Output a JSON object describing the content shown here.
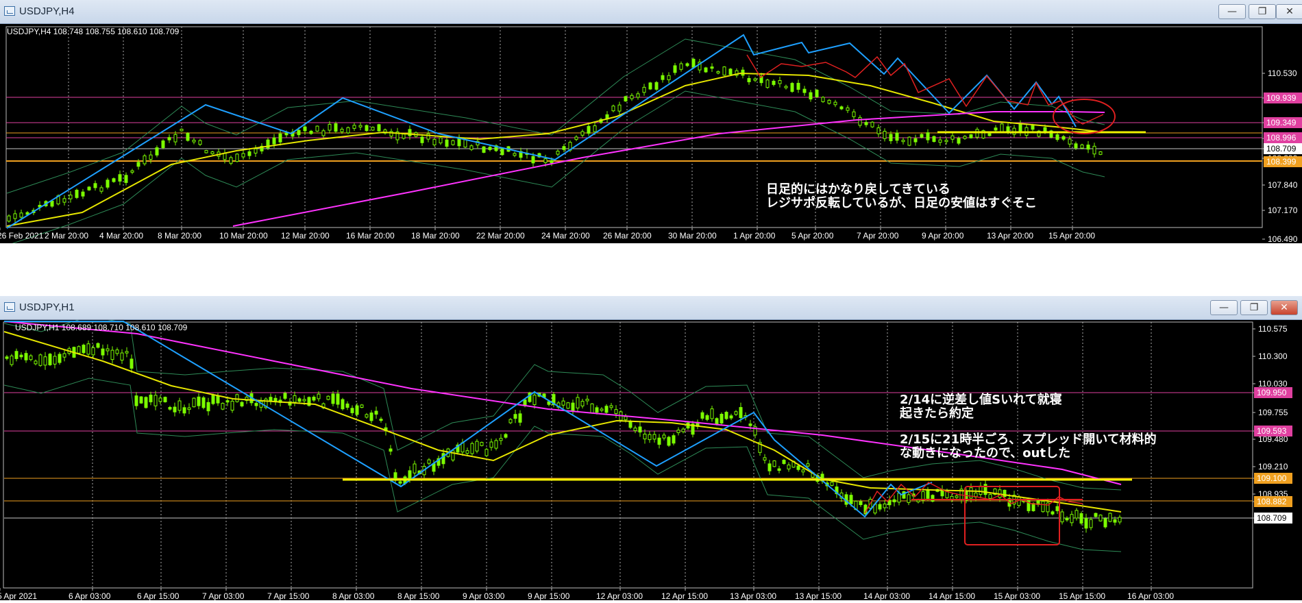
{
  "window_h4": {
    "title": "USDJPY,H4",
    "info": "USDJPY,H4  108.748 108.755 108.610 108.709",
    "price_ticks": [
      "110.530",
      "109.939",
      "109.349",
      "108.996",
      "108.709",
      "108.399",
      "107.840",
      "107.170",
      "106.490"
    ],
    "price_tags": [
      {
        "label": "109.939",
        "color": "#e040a0"
      },
      {
        "label": "109.349",
        "color": "#e040a0"
      },
      {
        "label": "108.996",
        "color": "#e040a0"
      },
      {
        "label": "108.709",
        "color": "#ffffff"
      },
      {
        "label": "108.399",
        "color": "#f0a020"
      }
    ],
    "time_labels": [
      "26 Feb 2021",
      "2 Mar 20:00",
      "4 Mar 20:00",
      "8 Mar 20:00",
      "10 Mar 20:00",
      "12 Mar 20:00",
      "16 Mar 20:00",
      "18 Mar 20:00",
      "22 Mar 20:00",
      "24 Mar 20:00",
      "26 Mar 20:00",
      "30 Mar 20:00",
      "1 Apr 20:00",
      "5 Apr 20:00",
      "7 Apr 20:00",
      "9 Apr 20:00",
      "13 Apr 20:00",
      "15 Apr 20:00"
    ],
    "note_line1": "日足的にはかなり戻してきている",
    "note_line2": "レジサポ反転しているが、日足の安値はすぐそこ"
  },
  "window_h1": {
    "title": "USDJPY,H1",
    "info": "USDJPY,H1  108.689 108.710 108.610 108.709",
    "price_ticks": [
      "110.575",
      "110.300",
      "110.030",
      "109.950",
      "109.755",
      "109.593",
      "109.480",
      "109.210",
      "109.100",
      "108.935",
      "108.882",
      "108.709"
    ],
    "price_tags": [
      {
        "label": "109.950",
        "color": "#e040a0"
      },
      {
        "label": "109.593",
        "color": "#e040a0"
      },
      {
        "label": "109.100",
        "color": "#f0a020"
      },
      {
        "label": "108.882",
        "color": "#f0a020"
      },
      {
        "label": "108.709",
        "color": "#ffffff"
      }
    ],
    "time_labels": [
      "5 Apr 2021",
      "6 Apr 03:00",
      "6 Apr 15:00",
      "7 Apr 03:00",
      "7 Apr 15:00",
      "8 Apr 03:00",
      "8 Apr 15:00",
      "9 Apr 03:00",
      "9 Apr 15:00",
      "12 Apr 03:00",
      "12 Apr 15:00",
      "13 Apr 03:00",
      "13 Apr 15:00",
      "14 Apr 03:00",
      "14 Apr 15:00",
      "15 Apr 03:00",
      "15 Apr 15:00",
      "16 Apr 03:00"
    ],
    "note_line1": "2/14に逆差し値Sいれて就寝",
    "note_line2": "起きたら約定",
    "note_line3": "2/15に21時半ごろ、スプレッド開いて材料的",
    "note_line4": "な動きになったので、outした"
  },
  "colors": {
    "background": "#000000",
    "grid": "#c8c8c8",
    "bull_candle": "#7cfc00",
    "zigzag": "#1ea0ff",
    "ma_fast": "#e6e600",
    "ma_slow": "#ff33ff",
    "bollinger": "#2e8b57",
    "hline_magenta": "#e040a0",
    "hline_orange": "#f0a020",
    "support_yellow": "#f0f000",
    "annotation_red": "#e02020"
  }
}
